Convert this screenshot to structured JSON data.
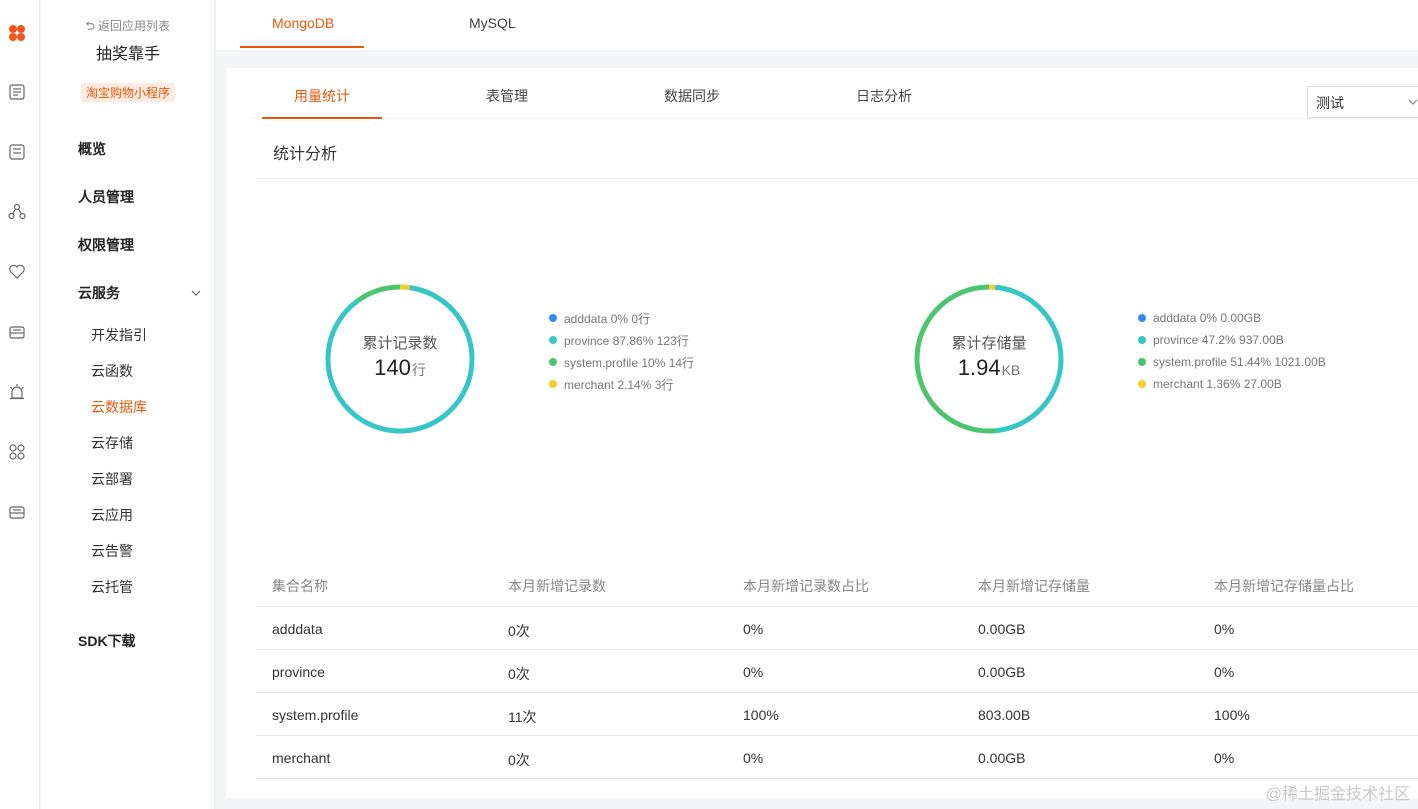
{
  "rail": {
    "icons": [
      "logo-icon",
      "document-icon",
      "list-icon",
      "share-icon",
      "heart-icon",
      "inbox-icon",
      "alarm-icon",
      "apps-icon",
      "archive-icon"
    ]
  },
  "sidebar": {
    "back_label": "返回应用列表",
    "app_name": "抽奖靠手",
    "app_tag": "淘宝购物小程序",
    "main_items": [
      "概览",
      "人员管理",
      "权限管理",
      "云服务",
      "SDK下载"
    ],
    "cloud_items": [
      "开发指引",
      "云函数",
      "云数据库",
      "云存储",
      "云部署",
      "云应用",
      "云告警",
      "云托管"
    ],
    "active_item": "云数据库"
  },
  "db_tabs": [
    "MongoDB",
    "MySQL"
  ],
  "sub_tabs": [
    "用量统计",
    "表管理",
    "数据同步",
    "日志分析"
  ],
  "env_select": "测试",
  "section_title": "统计分析",
  "colors": {
    "accent": "#e8590c",
    "blue": "#2f8cf0",
    "teal": "#36c6c6",
    "green": "#4dc46f",
    "yellow": "#f5cc33"
  },
  "records_chart": {
    "label": "累计记录数",
    "value": "140",
    "unit": "行",
    "legend": [
      {
        "text": "adddata 0% 0行",
        "color": "#2f8cf0"
      },
      {
        "text": "province 87.86% 123行",
        "color": "#36c6c6"
      },
      {
        "text": "system.profile 10% 14行",
        "color": "#4dc46f"
      },
      {
        "text": "merchant 2.14% 3行",
        "color": "#f5cc33"
      }
    ]
  },
  "storage_chart": {
    "label": "累计存储量",
    "value": "1.94",
    "unit": "KB",
    "legend": [
      {
        "text": "adddata 0% 0.00GB",
        "color": "#2f8cf0"
      },
      {
        "text": "province 47.2% 937.00B",
        "color": "#36c6c6"
      },
      {
        "text": "system.profile 51.44% 1021.00B",
        "color": "#4dc46f"
      },
      {
        "text": "merchant 1.36% 27.00B",
        "color": "#f5cc33"
      }
    ]
  },
  "chart_data": [
    {
      "type": "pie",
      "title": "累计记录数",
      "categories": [
        "adddata",
        "province",
        "system.profile",
        "merchant"
      ],
      "values": [
        0,
        87.86,
        10,
        2.14
      ],
      "counts": [
        0,
        123,
        14,
        3
      ],
      "total": 140,
      "colors": [
        "#2f8cf0",
        "#36c6c6",
        "#4dc46f",
        "#f5cc33"
      ]
    },
    {
      "type": "pie",
      "title": "累计存储量",
      "categories": [
        "adddata",
        "province",
        "system.profile",
        "merchant"
      ],
      "values": [
        0,
        47.2,
        51.44,
        1.36
      ],
      "colors": [
        "#2f8cf0",
        "#36c6c6",
        "#4dc46f",
        "#f5cc33"
      ]
    }
  ],
  "table": {
    "headers": [
      "集合名称",
      "本月新增记录数",
      "本月新增记录数占比",
      "本月新增记存储量",
      "本月新增记存储量占比"
    ],
    "rows": [
      [
        "adddata",
        "0次",
        "0%",
        "0.00GB",
        "0%"
      ],
      [
        "province",
        "0次",
        "0%",
        "0.00GB",
        "0%"
      ],
      [
        "system.profile",
        "11次",
        "100%",
        "803.00B",
        "100%"
      ],
      [
        "merchant",
        "0次",
        "0%",
        "0.00GB",
        "0%"
      ]
    ]
  },
  "watermark": "@稀土掘金技术社区"
}
